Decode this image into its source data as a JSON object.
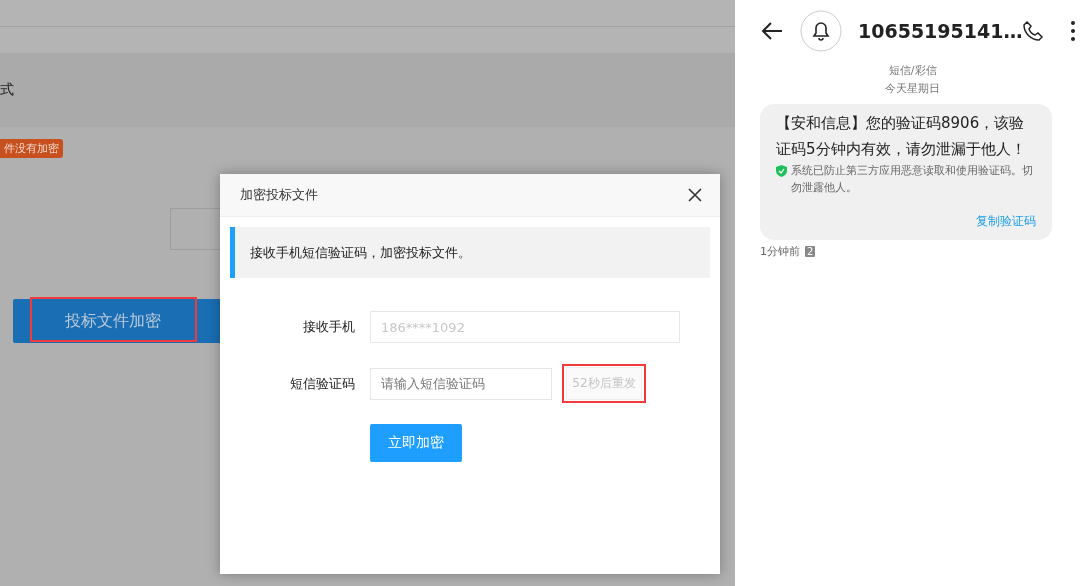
{
  "background_page": {
    "partial_label": "式",
    "status_tag": "件没有加密",
    "encrypt_button": "投标文件加密"
  },
  "dialog": {
    "title": "加密投标文件",
    "notice": "接收手机短信验证码，加密投标文件。",
    "fields": [
      {
        "label": "接收手机",
        "value": "186****1092",
        "disabled": true
      },
      {
        "label": "短信验证码",
        "placeholder": "请输入短信验证码"
      }
    ],
    "resend_button": {
      "label": "52秒后重发",
      "disabled": true
    },
    "submit_button": "立即加密"
  },
  "phone": {
    "sender": "10655195141…",
    "channel": "短信/彩信",
    "date": "今天星期日",
    "message": {
      "text": "【安和信息】您的验证码8906，该验证码5分钟内有效，请勿泄漏于他人！",
      "security_note": "系统已防止第三方应用恶意读取和使用验证码。切勿泄露他人。",
      "action": "复制验证码"
    },
    "time": "1分钟前",
    "sim": "2"
  }
}
